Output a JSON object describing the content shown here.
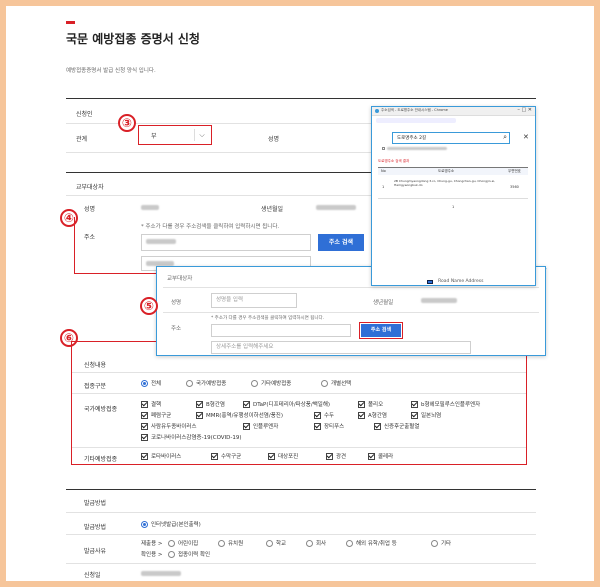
{
  "page": {
    "title": "국문 예방접종 증명서 신청",
    "subtitle": "예방접종증명서 발급 신청 양식 입니다."
  },
  "applicant": {
    "section": "신청인",
    "relation_label": "관계",
    "relation_value": "부",
    "name_label": "성명"
  },
  "recipient": {
    "section": "교부대상자",
    "name_label": "성명",
    "birth_label": "생년월일",
    "address_label": "주소",
    "address_note": "* 주소가 다를 경우 주소검색을 클릭하여 입력하시면 됩니다.",
    "address_search_button": "주소 검색"
  },
  "popup": {
    "title": "주소검색 - 도로명주소 안내시스템 - Chrome",
    "search_value": "도로명주소 2길",
    "tab_label": "도로명주소 검색 결과",
    "col_no": "No",
    "col_address": "도로명주소",
    "col_zip": "우편번호",
    "row_no": "1",
    "row_address": "2B Chungmyeongdong 3-ro, Chung-gu, Chongchan-gu, Chongjin-si, Hamgyeongbuk-do",
    "row_zip": "3560",
    "footer_text": "Road Name Address"
  },
  "zoom_form": {
    "section": "교부대상자",
    "name_label": "성명",
    "name_placeholder": "성명을 입력",
    "birth_label": "생년월일",
    "address_label": "주소",
    "address_note": "* 주소가 다를 경우 주소검색을 클릭하여 입력하시면 됩니다.",
    "search_button": "주소 검색",
    "detail_placeholder": "상세주소를 입력해주세요"
  },
  "vaccine": {
    "section": "신청내용",
    "type_label": "접종구분",
    "type_options": [
      "전체",
      "국가예방접종",
      "기타예방접종",
      "개별선택"
    ],
    "national_label": "국가예방접종",
    "national_items": [
      "결핵",
      "B형간염",
      "DTaP(디프테리아/파상풍/백일해)",
      "폴리오",
      "b형헤모필루스인플루엔자",
      "폐렴구균",
      "MMR(홍역/유행성이하선염/풍진)",
      "수두",
      "A형간염",
      "일본뇌염",
      "사람유두종바이러스",
      "인플루엔자",
      "장티푸스",
      "신증후군출혈열",
      "코로나바이러스감염증-19(COVID-19)"
    ],
    "other_label": "기타예방접종",
    "other_items": [
      "로타바이러스",
      "수막구균",
      "대상포진",
      "광견",
      "콜레라"
    ]
  },
  "issue": {
    "section": "발급방법",
    "method_label": "발급방법",
    "method_value": "인터넷발급(본인출력)",
    "reason_label": "발급사유",
    "reason_options": [
      "제출용 >",
      "어린이집",
      "유치원",
      "학교",
      "회사",
      "해외 유학/취업 등",
      "기타"
    ],
    "reason_options2": [
      "확인용 >",
      "접종이력 확인"
    ],
    "date_label": "신청일"
  },
  "badges": [
    "③",
    "④",
    "⑤",
    "⑥"
  ],
  "colors": {
    "accent": "#2f6fd6",
    "highlight": "#d92027",
    "frame": "#f6c59a",
    "popup_border": "#3a9ad9"
  }
}
